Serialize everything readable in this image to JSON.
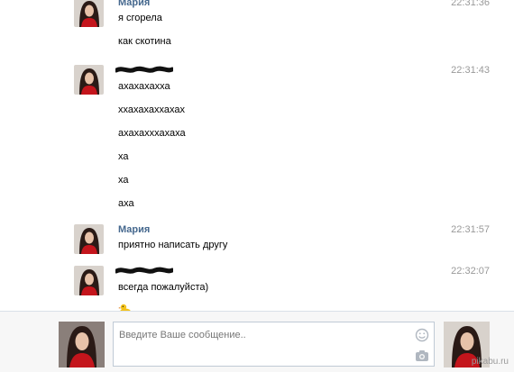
{
  "messages": [
    {
      "author": "Мария",
      "time": "22:31:36",
      "lines": [
        "я сгорела",
        "как скотина"
      ],
      "author_redacted": false
    },
    {
      "author": "",
      "time": "22:31:43",
      "lines": [
        "ахахахахха",
        "ххахахаххахах",
        "ахахахххахаха",
        "ха",
        "ха",
        "аха"
      ],
      "author_redacted": true
    },
    {
      "author": "Мария",
      "time": "22:31:57",
      "lines": [
        "приятно написать другу"
      ],
      "author_redacted": false
    },
    {
      "author": "",
      "time": "22:32:07",
      "lines": [
        "всегда пожалуйста)"
      ],
      "author_redacted": true,
      "emoji": "duck-emoji"
    }
  ],
  "composer": {
    "placeholder": "Введите Ваше сообщение..",
    "icons": [
      "smile-icon",
      "camera-icon"
    ]
  },
  "watermark": "pikabu.ru",
  "colors": {
    "author_name": "#45688e",
    "time": "#999999",
    "composer_bg": "#f7f7f7",
    "input_border": "#c0cad5",
    "accent_red": "#c4151c"
  }
}
